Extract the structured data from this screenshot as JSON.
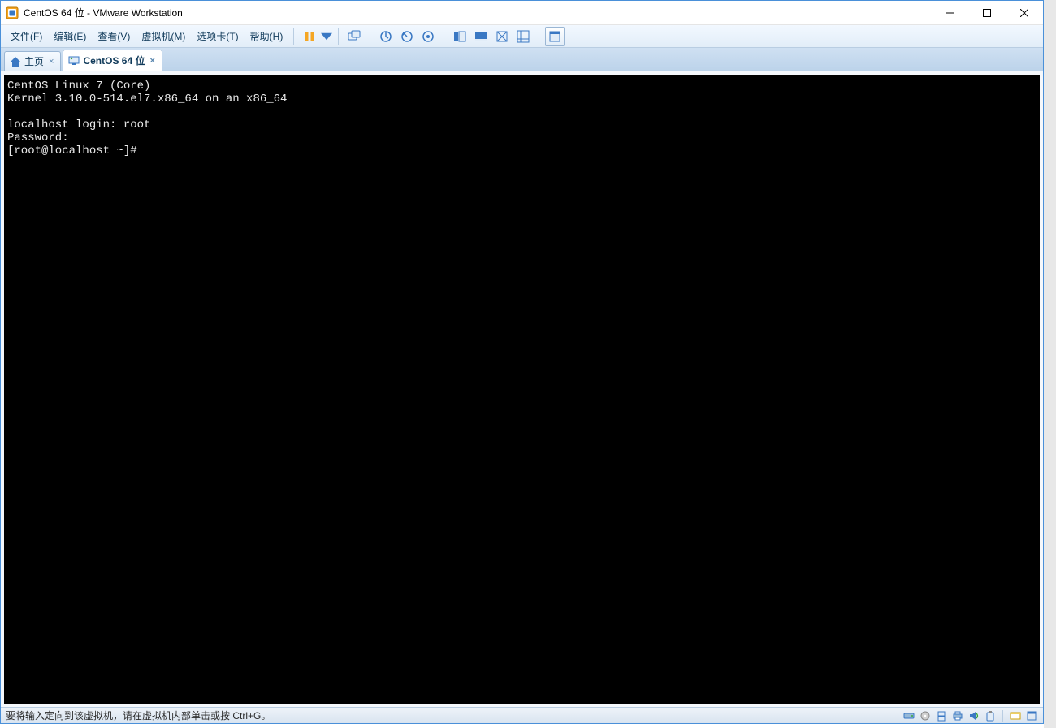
{
  "titlebar": {
    "title": "CentOS 64 位 - VMware Workstation"
  },
  "menu": {
    "file": "文件(F)",
    "edit": "编辑(E)",
    "view": "查看(V)",
    "vm": "虚拟机(M)",
    "tabs": "选项卡(T)",
    "help": "帮助(H)"
  },
  "tabs": {
    "home": "主页",
    "active": "CentOS 64 位"
  },
  "console": {
    "line1": "CentOS Linux 7 (Core)",
    "line2": "Kernel 3.10.0-514.el7.x86_64 on an x86_64",
    "blank1": "",
    "line3": "localhost login: root",
    "line4": "Password:",
    "line5": "[root@localhost ~]#"
  },
  "statusbar": {
    "hint": "要将输入定向到该虚拟机，请在虚拟机内部单击或按 Ctrl+G。"
  },
  "colors": {
    "accent": "#4a90d9",
    "pause_orange": "#f5a623"
  }
}
